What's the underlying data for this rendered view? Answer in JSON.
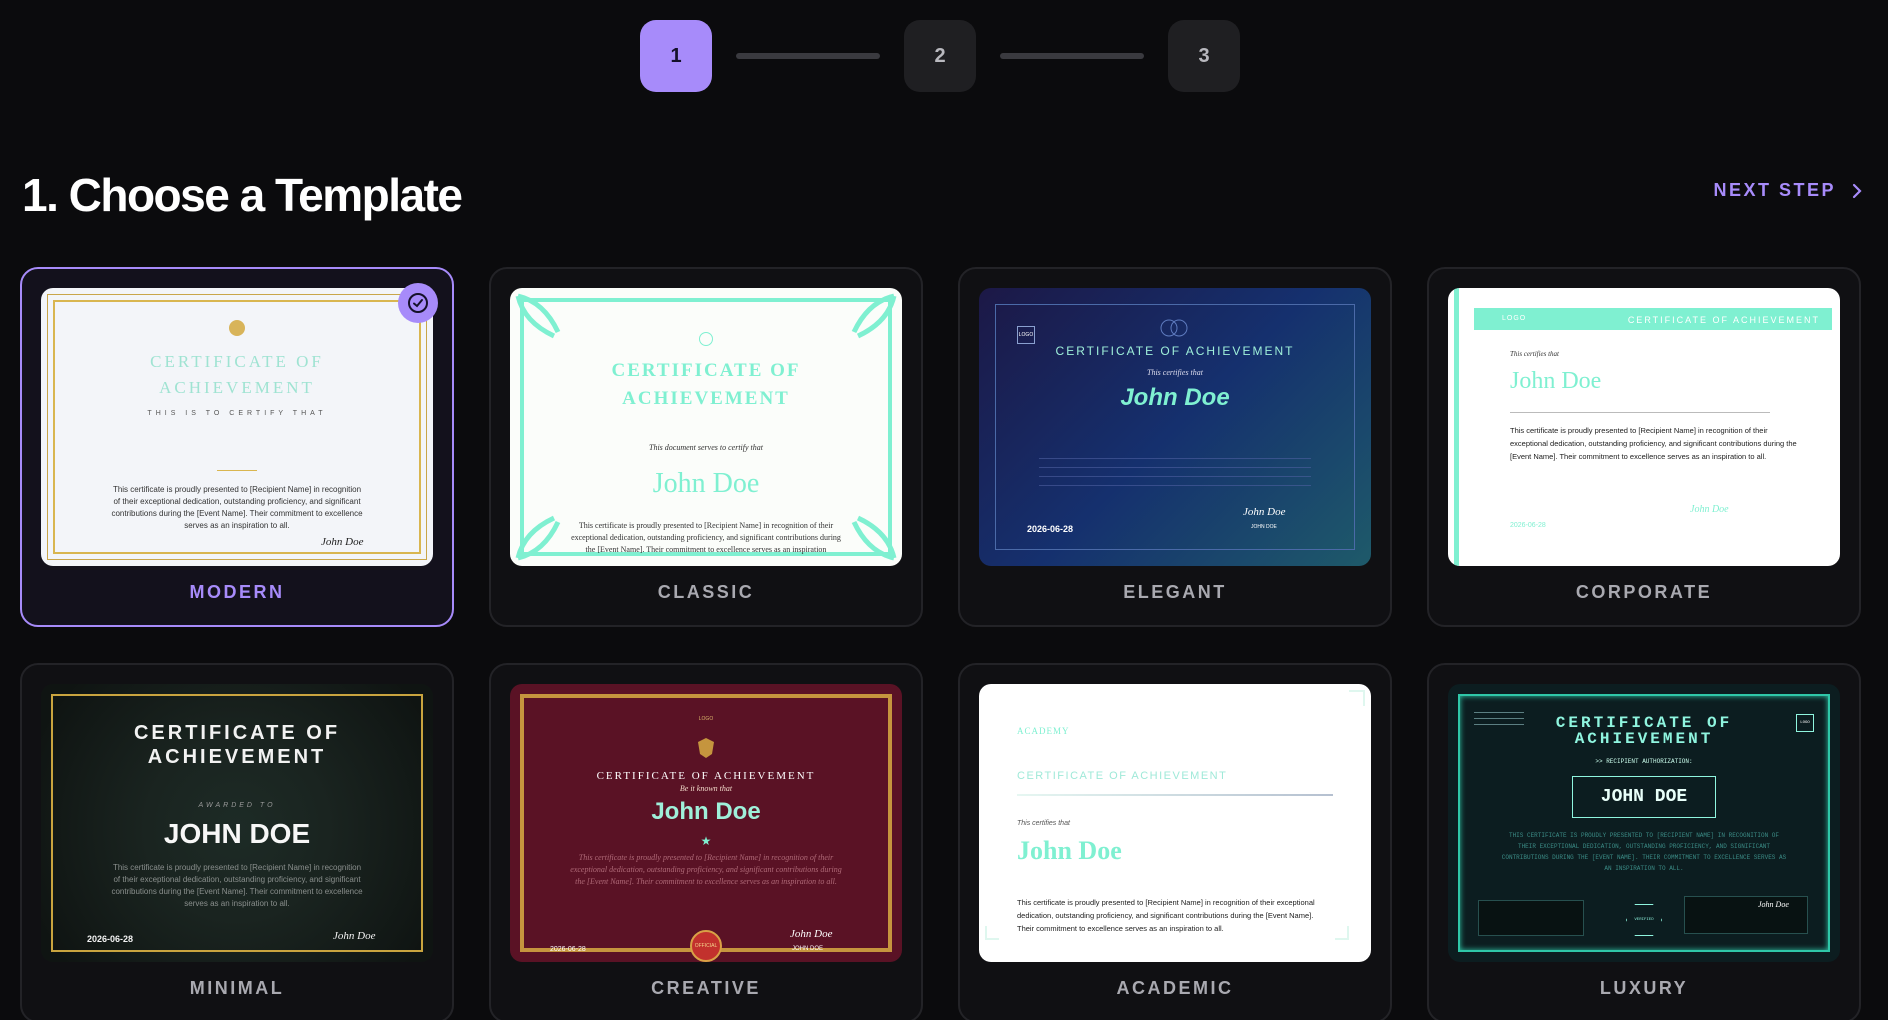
{
  "stepper": {
    "steps": [
      "1",
      "2",
      "3"
    ],
    "active_index": 0
  },
  "header": {
    "title": "1. Choose a Template",
    "next_label": "NEXT STEP"
  },
  "colors": {
    "accent": "#a78bfa",
    "mint": "#7ff0d1",
    "gold": "#c9a64a"
  },
  "templates": [
    {
      "label": "MODERN",
      "selected": true,
      "title1": "CERTIFICATE OF",
      "title2": "ACHIEVEMENT",
      "subtitle": "THIS IS TO CERTIFY THAT",
      "body": "This certificate is proudly presented to [Recipient Name] in recognition of their exceptional dedication, outstanding proficiency, and significant contributions during the [Event Name]. Their commitment to excellence serves as an inspiration to all.",
      "signature": "John Doe"
    },
    {
      "label": "CLASSIC",
      "selected": false,
      "title1": "CERTIFICATE OF",
      "title2": "ACHIEVEMENT",
      "subtitle": "This document serves to certify that",
      "name": "John Doe",
      "body": "This certificate is proudly presented to [Recipient Name] in recognition of their exceptional dedication, outstanding proficiency, and significant contributions during the [Event Name]. Their commitment to excellence serves as an inspiration"
    },
    {
      "label": "ELEGANT",
      "selected": false,
      "logo": "LOGO",
      "title": "CERTIFICATE OF ACHIEVEMENT",
      "subtitle": "This certifies that",
      "name": "John Doe",
      "date": "2026-06-28",
      "signature": "John Doe",
      "signer": "JOHN DOE"
    },
    {
      "label": "CORPORATE",
      "selected": false,
      "logo": "LOGO",
      "band": "CERTIFICATE OF ACHIEVEMENT",
      "subtitle": "This certifies that",
      "name": "John Doe",
      "body": "This certificate is proudly presented to [Recipient Name] in recognition of their exceptional dedication, outstanding proficiency, and significant contributions during the [Event Name]. Their commitment to excellence serves as an inspiration to all.",
      "date": "2026-06-28",
      "signature": "John Doe"
    },
    {
      "label": "MINIMAL",
      "selected": false,
      "title1": "CERTIFICATE OF",
      "title2": "ACHIEVEMENT",
      "awarded": "AWARDED TO",
      "name": "JOHN DOE",
      "body": "This certificate is proudly presented to [Recipient Name] in recognition of their exceptional dedication, outstanding proficiency, and significant contributions during the [Event Name]. Their commitment to excellence serves as an inspiration to all.",
      "date": "2026-06-28",
      "signature": "John Doe"
    },
    {
      "label": "CREATIVE",
      "selected": false,
      "logo": "LOGO",
      "title": "CERTIFICATE OF ACHIEVEMENT",
      "subtitle": "Be it known that",
      "name": "John Doe",
      "star": "★",
      "body": "This certificate is proudly presented to [Recipient Name] in recognition of their exceptional dedication, outstanding proficiency, and significant contributions during the [Event Name]. Their commitment to excellence serves as an inspiration to all.",
      "date": "2026-06-28",
      "signer": "JOHN DOE",
      "signature": "John Doe",
      "seal": "OFFICIAL"
    },
    {
      "label": "ACADEMIC",
      "selected": false,
      "brand": "ACADEMY",
      "title": "CERTIFICATE OF ACHIEVEMENT",
      "subtitle": "This certifies that",
      "name": "John Doe",
      "body": "This certificate is proudly presented to [Recipient Name] in recognition of their exceptional dedication, outstanding proficiency, and significant contributions during the [Event Name]. Their commitment to excellence serves as an inspiration to all."
    },
    {
      "label": "LUXURY",
      "selected": false,
      "title1": "CERTIFICATE OF",
      "title2": "ACHIEVEMENT",
      "auth": ">> RECIPIENT AUTHORIZATION:",
      "name": "JOHN DOE",
      "body": "THIS CERTIFICATE IS PROUDLY PRESENTED TO [RECIPIENT NAME] IN RECOGNITION OF THEIR EXCEPTIONAL DEDICATION, OUTSTANDING PROFICIENCY, AND SIGNIFICANT CONTRIBUTIONS DURING THE [EVENT NAME]. THEIR COMMITMENT TO EXCELLENCE SERVES AS AN INSPIRATION TO ALL.",
      "logo": "LOGO",
      "signature": "John Doe",
      "badge": "VERIFIED"
    }
  ]
}
